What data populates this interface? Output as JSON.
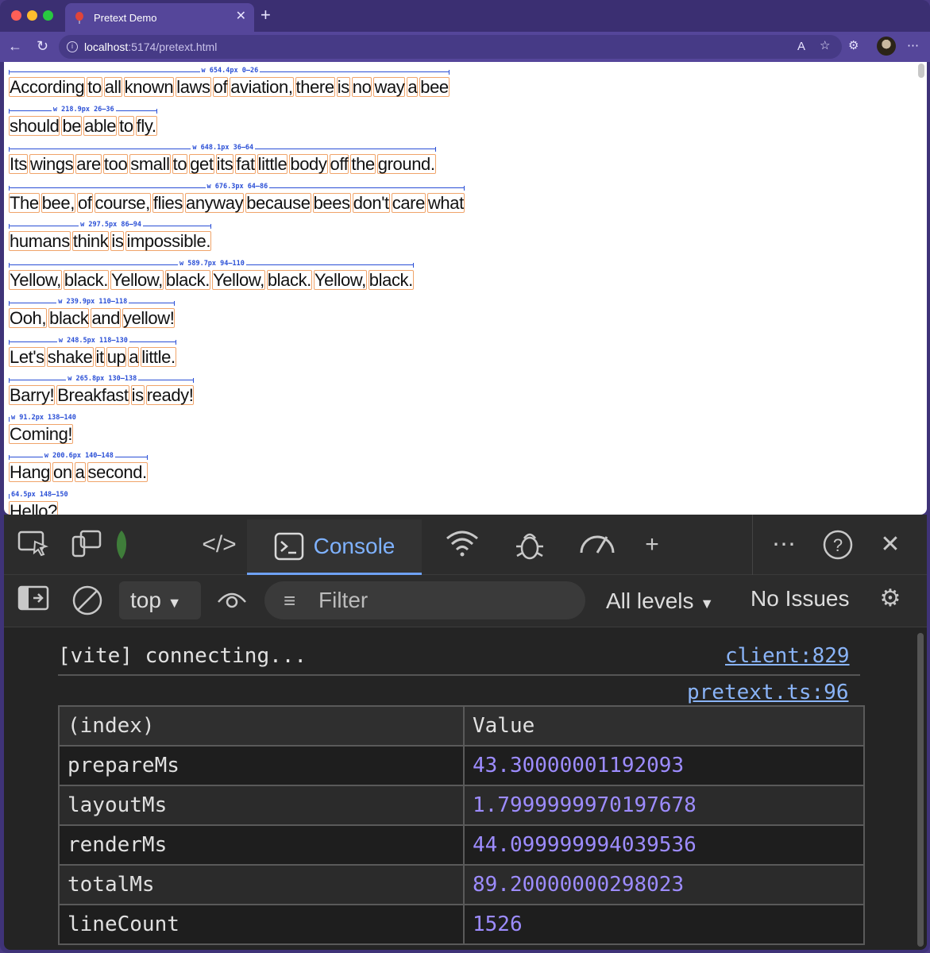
{
  "browser": {
    "tab_title": "Pretext Demo",
    "url_host": "localhost",
    "url_path": ":5174/pretext.html"
  },
  "page": {
    "lines": [
      {
        "label": "w 654.4px 0–26",
        "words": [
          "According",
          "to",
          "all",
          "known",
          "laws",
          "of",
          "aviation,",
          "there",
          "is",
          "no",
          "way",
          "a",
          "bee"
        ]
      },
      {
        "label": "w 218.9px 26–36",
        "words": [
          "should",
          "be",
          "able",
          "to",
          "fly."
        ]
      },
      {
        "label": "w 648.1px 36–64",
        "words": [
          "Its",
          "wings",
          "are",
          "too",
          "small",
          "to",
          "get",
          "its",
          "fat",
          "little",
          "body",
          "off",
          "the",
          "ground."
        ]
      },
      {
        "label": "w 676.3px 64–86",
        "words": [
          "The",
          "bee,",
          "of",
          "course,",
          "flies",
          "anyway",
          "because",
          "bees",
          "don't",
          "care",
          "what"
        ]
      },
      {
        "label": "w 297.5px 86–94",
        "words": [
          "humans",
          "think",
          "is",
          "impossible."
        ]
      },
      {
        "label": "w 589.7px 94–110",
        "words": [
          "Yellow,",
          "black.",
          "Yellow,",
          "black.",
          "Yellow,",
          "black.",
          "Yellow,",
          "black."
        ]
      },
      {
        "label": "w 239.9px 110–118",
        "words": [
          "Ooh,",
          "black",
          "and",
          "yellow!"
        ]
      },
      {
        "label": "w 248.5px 118–130",
        "words": [
          "Let's",
          "shake",
          "it",
          "up",
          "a",
          "little."
        ]
      },
      {
        "label": "w 265.8px 130–138",
        "words": [
          "Barry!",
          "Breakfast",
          "is",
          "ready!"
        ]
      },
      {
        "label": "w 91.2px 138–140",
        "words": [
          "Coming!"
        ]
      },
      {
        "label": "w 200.6px 140–148",
        "words": [
          "Hang",
          "on",
          "a",
          "second."
        ]
      },
      {
        "label": "64.5px 148–150",
        "words": [
          "Hello?"
        ]
      }
    ]
  },
  "devtools": {
    "tab_console": "Console",
    "context": "top",
    "filter_placeholder": "Filter",
    "levels": "All levels",
    "issues": "No Issues",
    "log_message": "[vite] connecting...",
    "log_source": "client:829",
    "table_source": "pretext.ts:96",
    "table_headers": [
      "(index)",
      "Value"
    ],
    "table_rows": [
      {
        "index": "prepareMs",
        "value": "43.30000001192093"
      },
      {
        "index": "layoutMs",
        "value": "1.7999999970197678"
      },
      {
        "index": "renderMs",
        "value": "44.099999994039536"
      },
      {
        "index": "totalMs",
        "value": "89.20000000298023"
      },
      {
        "index": "lineCount",
        "value": "1526"
      }
    ]
  }
}
